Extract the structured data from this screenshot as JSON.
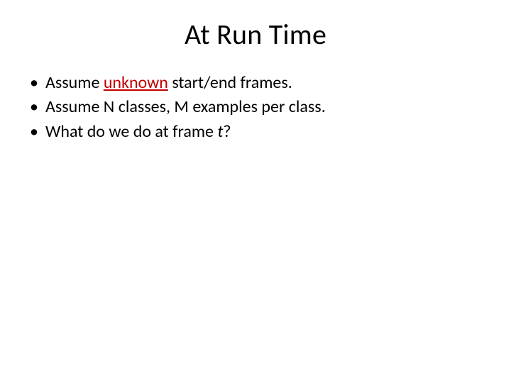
{
  "title": "At Run Time",
  "bullets": [
    {
      "pre": "Assume ",
      "em": "unknown",
      "post": " start/end frames."
    },
    {
      "text": "Assume N classes, M examples per class."
    },
    {
      "pre": "What do we do at frame ",
      "ital": "t",
      "post": "?"
    }
  ]
}
